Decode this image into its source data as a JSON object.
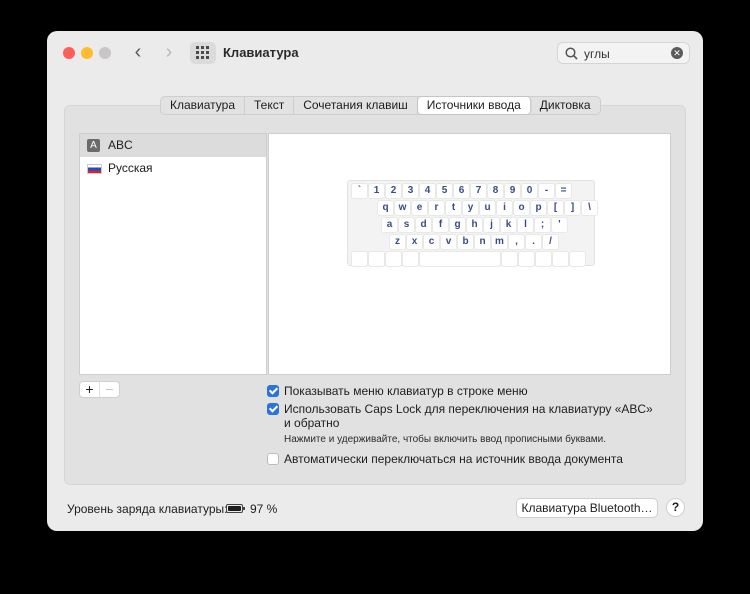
{
  "window": {
    "title": "Клавиатура",
    "search": {
      "value": "углы"
    }
  },
  "tabs": [
    {
      "label": "Клавиатура",
      "active": false
    },
    {
      "label": "Текст",
      "active": false
    },
    {
      "label": "Сочетания клавиш",
      "active": false
    },
    {
      "label": "Источники ввода",
      "active": true
    },
    {
      "label": "Диктовка",
      "active": false
    }
  ],
  "sources": [
    {
      "label": "ABC",
      "icon": "A",
      "selected": true
    },
    {
      "label": "Русская",
      "icon": "russian-flag",
      "selected": false
    }
  ],
  "keyboard_preview": {
    "rows": [
      [
        "`",
        "1",
        "2",
        "3",
        "4",
        "5",
        "6",
        "7",
        "8",
        "9",
        "0",
        "-",
        "="
      ],
      [
        "q",
        "w",
        "e",
        "r",
        "t",
        "y",
        "u",
        "i",
        "o",
        "p",
        "[",
        "]",
        "\\"
      ],
      [
        "a",
        "s",
        "d",
        "f",
        "g",
        "h",
        "j",
        "k",
        "l",
        ";",
        "'"
      ],
      [
        "z",
        "x",
        "c",
        "v",
        "b",
        "n",
        "m",
        ",",
        ".",
        "/"
      ]
    ]
  },
  "buttons": {
    "add": "+",
    "remove": "−",
    "bluetooth": "Клавиатура Bluetooth…",
    "help": "?"
  },
  "options": {
    "show_menu": {
      "label": "Показывать меню клавиатур в строке меню",
      "checked": true
    },
    "caps_lock": {
      "label_line1": "Использовать Caps Lock для переключения на клавиатуру «ABC»",
      "label_line2": "и обратно",
      "checked": true
    },
    "caps_hint": "Нажмите и удерживайте, чтобы включить ввод прописными буквами.",
    "auto_switch": {
      "label": "Автоматически переключаться на источник ввода документа",
      "checked": false
    }
  },
  "battery": {
    "label": "Уровень заряда клавиатуры:",
    "percent_text": "97 %",
    "level": 0.97
  },
  "colors": {
    "accent": "#2d74d9",
    "key_text": "#3c4a83"
  }
}
